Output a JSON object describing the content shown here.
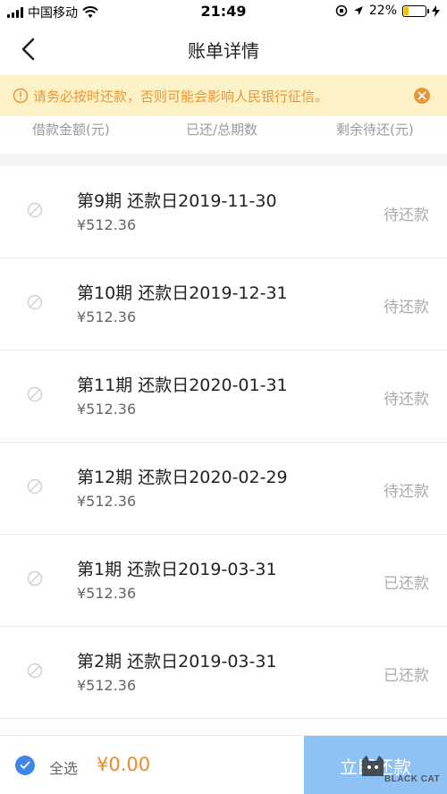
{
  "status_bar": {
    "carrier": "中国移动",
    "time": "21:49",
    "battery_percent": "22%",
    "battery_level": 0.22
  },
  "nav": {
    "title": "账单详情"
  },
  "notice": {
    "text": "请务必按时还款，否则可能会影响人民银行征信。"
  },
  "summary_header": {
    "col1": "借款金额(元)",
    "col2": "已还/总期数",
    "col3": "剩余待还(元)"
  },
  "rows": [
    {
      "title": "第9期 还款日2019-11-30",
      "amount": "¥512.36",
      "status": "待还款"
    },
    {
      "title": "第10期 还款日2019-12-31",
      "amount": "¥512.36",
      "status": "待还款"
    },
    {
      "title": "第11期 还款日2020-01-31",
      "amount": "¥512.36",
      "status": "待还款"
    },
    {
      "title": "第12期 还款日2020-02-29",
      "amount": "¥512.36",
      "status": "待还款"
    },
    {
      "title": "第1期 还款日2019-03-31",
      "amount": "¥512.36",
      "status": "已还款"
    },
    {
      "title": "第2期 还款日2019-03-31",
      "amount": "¥512.36",
      "status": "已还款"
    }
  ],
  "bottom_bar": {
    "select_all_label": "全选",
    "total": "¥0.00",
    "pay_label": "立即还款"
  },
  "watermark": {
    "text": "BLACK CAT"
  },
  "colors": {
    "notice_bg": "#fdf2c6",
    "notice_text": "#e8963a",
    "accent_blue": "#3f86e8",
    "amount_orange": "#f08a28",
    "pay_button": "#8ec1f4"
  }
}
